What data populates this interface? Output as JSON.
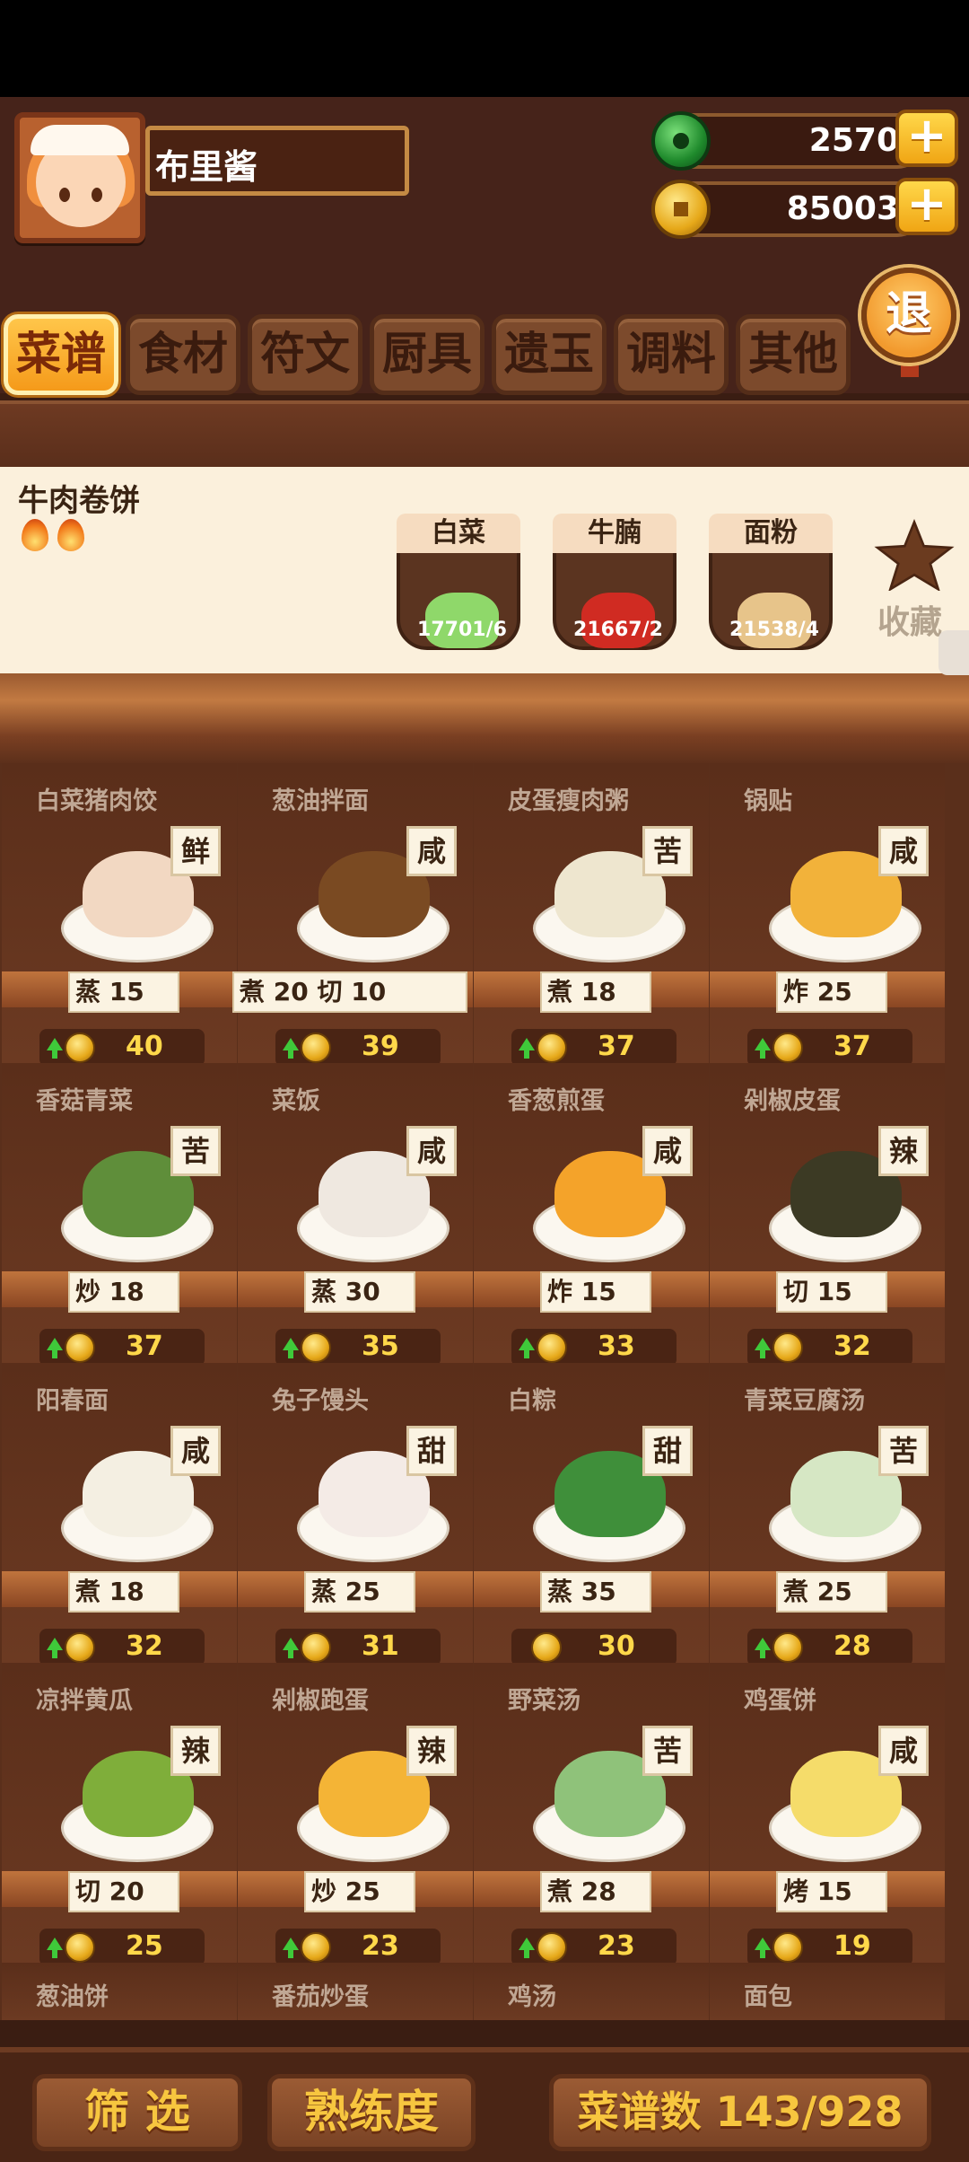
{
  "player": {
    "name": "布里酱"
  },
  "currency": {
    "jade": "2570",
    "coins": "85003"
  },
  "exit_label": "退",
  "tabs": [
    {
      "label": "菜谱",
      "active": true
    },
    {
      "label": "食材",
      "active": false
    },
    {
      "label": "符文",
      "active": false
    },
    {
      "label": "厨具",
      "active": false
    },
    {
      "label": "遗玉",
      "active": false
    },
    {
      "label": "调料",
      "active": false
    },
    {
      "label": "其他",
      "active": false
    }
  ],
  "selected": {
    "title": "牛肉卷饼",
    "fire_count": 2,
    "ingredients": [
      {
        "name": "白菜",
        "count": "17701/6",
        "icon": "cabbage-icon",
        "color": "#8fd86a"
      },
      {
        "name": "牛腩",
        "count": "21667/2",
        "icon": "beef-icon",
        "color": "#d02b22"
      },
      {
        "name": "面粉",
        "count": "21538/4",
        "icon": "flour-sack-icon",
        "color": "#e7c48a"
      }
    ],
    "favorite_label": "收藏"
  },
  "recipes": [
    {
      "name": "白菜猪肉饺",
      "taste": "鲜",
      "methods": [
        {
          "m": "蒸",
          "v": "15"
        }
      ],
      "price": "40",
      "up": true,
      "color": "#f2d8c2"
    },
    {
      "name": "葱油拌面",
      "taste": "咸",
      "methods": [
        {
          "m": "煮",
          "v": "20"
        },
        {
          "m": "切",
          "v": "10"
        }
      ],
      "price": "39",
      "up": true,
      "color": "#7a4a22"
    },
    {
      "name": "皮蛋瘦肉粥",
      "taste": "苦",
      "methods": [
        {
          "m": "煮",
          "v": "18"
        }
      ],
      "price": "37",
      "up": true,
      "color": "#eee6cf"
    },
    {
      "name": "锅贴",
      "taste": "咸",
      "methods": [
        {
          "m": "炸",
          "v": "25"
        }
      ],
      "price": "37",
      "up": true,
      "color": "#f2b23a"
    },
    {
      "name": "香菇青菜",
      "taste": "苦",
      "methods": [
        {
          "m": "炒",
          "v": "18"
        }
      ],
      "price": "37",
      "up": true,
      "color": "#5f8e3a"
    },
    {
      "name": "菜饭",
      "taste": "咸",
      "methods": [
        {
          "m": "蒸",
          "v": "30"
        }
      ],
      "price": "35",
      "up": true,
      "color": "#efe8e0"
    },
    {
      "name": "香葱煎蛋",
      "taste": "咸",
      "methods": [
        {
          "m": "炸",
          "v": "15"
        }
      ],
      "price": "33",
      "up": true,
      "color": "#f4a32a"
    },
    {
      "name": "剁椒皮蛋",
      "taste": "辣",
      "methods": [
        {
          "m": "切",
          "v": "15"
        }
      ],
      "price": "32",
      "up": true,
      "color": "#3c3a24"
    },
    {
      "name": "阳春面",
      "taste": "咸",
      "methods": [
        {
          "m": "煮",
          "v": "18"
        }
      ],
      "price": "32",
      "up": true,
      "color": "#f4efe2"
    },
    {
      "name": "兔子馒头",
      "taste": "甜",
      "methods": [
        {
          "m": "蒸",
          "v": "25"
        }
      ],
      "price": "31",
      "up": true,
      "color": "#f4ebe6"
    },
    {
      "name": "白粽",
      "taste": "甜",
      "methods": [
        {
          "m": "蒸",
          "v": "35"
        }
      ],
      "price": "30",
      "up": false,
      "color": "#3f8f3a"
    },
    {
      "name": "青菜豆腐汤",
      "taste": "苦",
      "methods": [
        {
          "m": "煮",
          "v": "25"
        }
      ],
      "price": "28",
      "up": true,
      "color": "#d6e7c4"
    },
    {
      "name": "凉拌黄瓜",
      "taste": "辣",
      "methods": [
        {
          "m": "切",
          "v": "20"
        }
      ],
      "price": "25",
      "up": true,
      "color": "#7fae3a"
    },
    {
      "name": "剁椒跑蛋",
      "taste": "辣",
      "methods": [
        {
          "m": "炒",
          "v": "25"
        }
      ],
      "price": "23",
      "up": true,
      "color": "#f4b436"
    },
    {
      "name": "野菜汤",
      "taste": "苦",
      "methods": [
        {
          "m": "煮",
          "v": "28"
        }
      ],
      "price": "23",
      "up": true,
      "color": "#8fc27a"
    },
    {
      "name": "鸡蛋饼",
      "taste": "咸",
      "methods": [
        {
          "m": "烤",
          "v": "15"
        }
      ],
      "price": "19",
      "up": true,
      "color": "#f5dc6a"
    }
  ],
  "partial_row": [
    "葱油饼",
    "番茄炒蛋",
    "鸡汤",
    "面包"
  ],
  "bottom": {
    "filter": "筛 选",
    "proficiency": "熟练度",
    "recipe_count": "菜谱数 143/928"
  }
}
